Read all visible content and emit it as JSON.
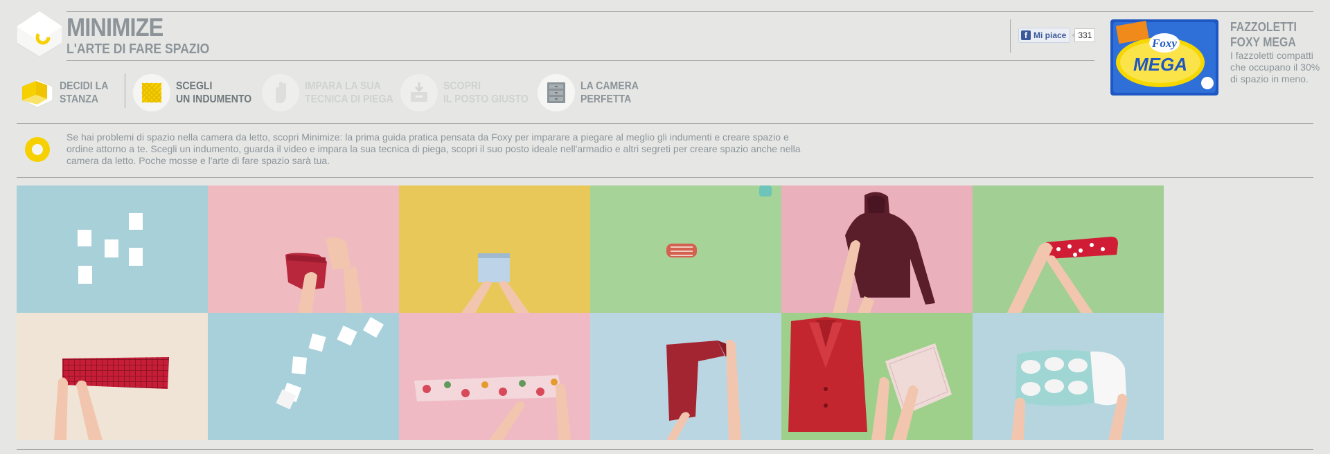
{
  "header": {
    "title": "MINIMIZE",
    "subtitle": "L'ARTE DI FARE SPAZIO"
  },
  "social": {
    "like_label": "Mi piace",
    "like_count": "331"
  },
  "product": {
    "title_line1": "FAZZOLETTI",
    "title_line2": "FOXY MEGA",
    "description": "I fazzoletti compatti che occupano il 30% di spazio in meno.",
    "image_brand": "Foxy",
    "image_name": "MEGA"
  },
  "steps": [
    {
      "line1": "DECIDI LA",
      "line2": "STANZA",
      "icon": "room-cube-icon",
      "state": "normal"
    },
    {
      "line1": "SCEGLI",
      "line2": "UN INDUMENTO",
      "icon": "garment-pattern-icon",
      "state": "active"
    },
    {
      "line1": "IMPARA LA SUA",
      "line2": "TECNICA DI PIEGA",
      "icon": "hand-icon",
      "state": "disabled"
    },
    {
      "line1": "SCOPRI",
      "line2": "IL POSTO GIUSTO",
      "icon": "drawer-box-icon",
      "state": "disabled"
    },
    {
      "line1": "LA CAMERA",
      "line2": "PERFETTA",
      "icon": "dresser-icon",
      "state": "normal"
    }
  ],
  "intro": {
    "text": "Se hai problemi di spazio nella camera da letto, scopri Minimize: la prima guida pratica pensata da Foxy per imparare a piegare al meglio gli indumenti e creare spazio e ordine attorno a te. Scegli un indumento, guarda il video e impara la sua tecnica di piega, scopri il suo posto ideale nell'armadio e altri segreti per creare spazio anche nella camera da letto. Poche mosse e l'arte di fare spazio sarà tua."
  },
  "colors": {
    "background": "#e6e7e5",
    "text_gray": "#8c9499",
    "accent_yellow": "#f6d000",
    "facebook_blue": "#3b5998"
  },
  "tiles": [
    {
      "name": "tile-white-squares",
      "bg": "#a8d0d9",
      "subject": "white napkins"
    },
    {
      "name": "tile-red-briefs",
      "bg": "#f0bac1",
      "subject": "red briefs"
    },
    {
      "name": "tile-denim-shorts",
      "bg": "#e9c85a",
      "subject": "denim shorts"
    },
    {
      "name": "tile-rolled-item",
      "bg": "#a6d398",
      "subject": "rolled striped item"
    },
    {
      "name": "tile-burgundy-hoodie",
      "bg": "#eab0bb",
      "subject": "burgundy hoodie"
    },
    {
      "name": "tile-polka-socks",
      "bg": "#a2cf93",
      "subject": "red polka dot socks"
    },
    {
      "name": "tile-plaid-scarf",
      "bg": "#efe4d5",
      "subject": "red plaid scarf"
    },
    {
      "name": "tile-folded-squares",
      "bg": "#a7d0da",
      "subject": "folded napkins"
    },
    {
      "name": "tile-floral-trousers",
      "bg": "#efbac3",
      "subject": "floral trousers"
    },
    {
      "name": "tile-red-shirt",
      "bg": "#bad6e2",
      "subject": "red shirt"
    },
    {
      "name": "tile-red-coat",
      "bg": "#9fd08b",
      "subject": "red coat and pink cloth"
    },
    {
      "name": "tile-pillow",
      "bg": "#b6d5df",
      "subject": "patterned pillow"
    }
  ]
}
